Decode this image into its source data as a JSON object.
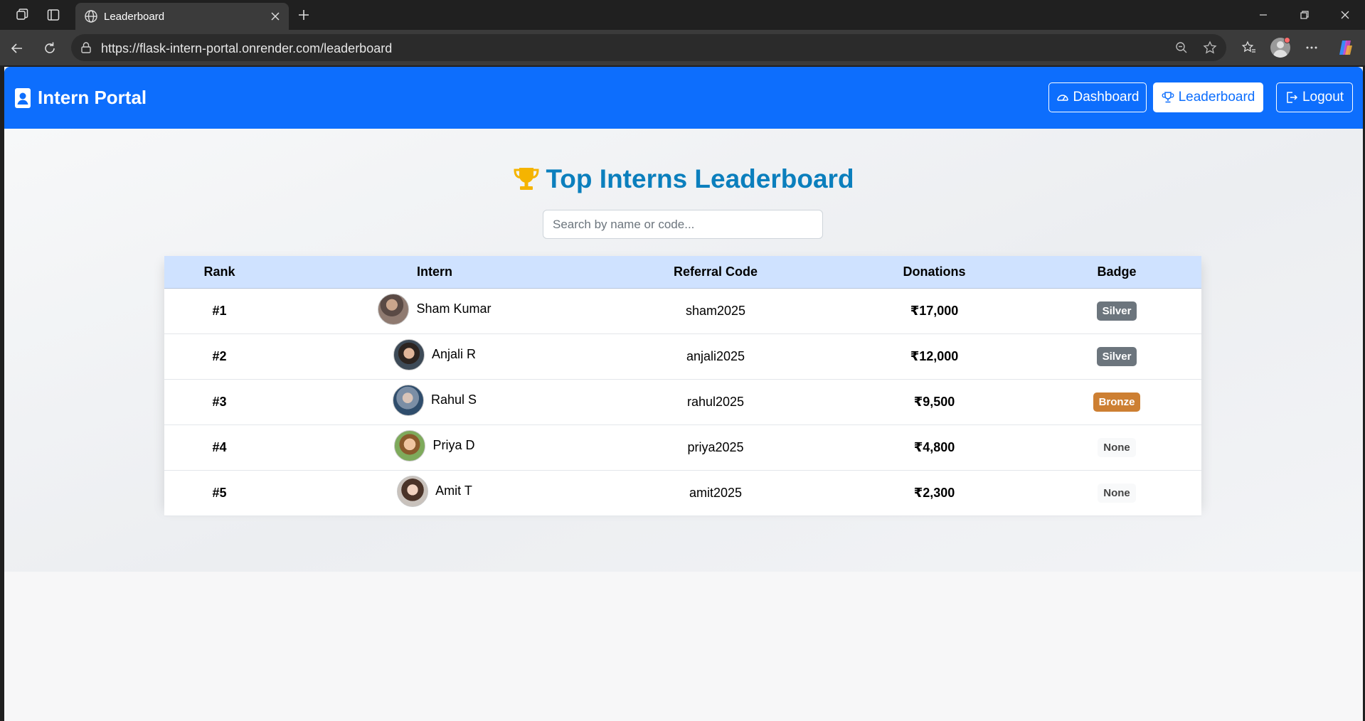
{
  "browser": {
    "tab_title": "Leaderboard",
    "url": "https://flask-intern-portal.onrender.com/leaderboard"
  },
  "app": {
    "brand": "Intern Portal",
    "nav": {
      "dashboard": "Dashboard",
      "leaderboard": "Leaderboard",
      "logout": "Logout"
    }
  },
  "page": {
    "title": "Top Interns Leaderboard",
    "search_placeholder": "Search by name or code..."
  },
  "table": {
    "headers": [
      "Rank",
      "Intern",
      "Referral Code",
      "Donations",
      "Badge"
    ],
    "rows": [
      {
        "rank": "#1",
        "name": "Sham Kumar",
        "code": "sham2025",
        "donations": "₹17,000",
        "badge": "Silver",
        "badge_type": "silver"
      },
      {
        "rank": "#2",
        "name": "Anjali R",
        "code": "anjali2025",
        "donations": "₹12,000",
        "badge": "Silver",
        "badge_type": "silver"
      },
      {
        "rank": "#3",
        "name": "Rahul S",
        "code": "rahul2025",
        "donations": "₹9,500",
        "badge": "Bronze",
        "badge_type": "bronze"
      },
      {
        "rank": "#4",
        "name": "Priya D",
        "code": "priya2025",
        "donations": "₹4,800",
        "badge": "None",
        "badge_type": "none"
      },
      {
        "rank": "#5",
        "name": "Amit T",
        "code": "amit2025",
        "donations": "₹2,300",
        "badge": "None",
        "badge_type": "none"
      }
    ]
  },
  "colors": {
    "navbar": "#0d6efd",
    "heading": "#0b7fbd",
    "header_row": "#cfe2ff",
    "badge_silver": "#6c757d",
    "badge_bronze": "#cd7f32"
  }
}
